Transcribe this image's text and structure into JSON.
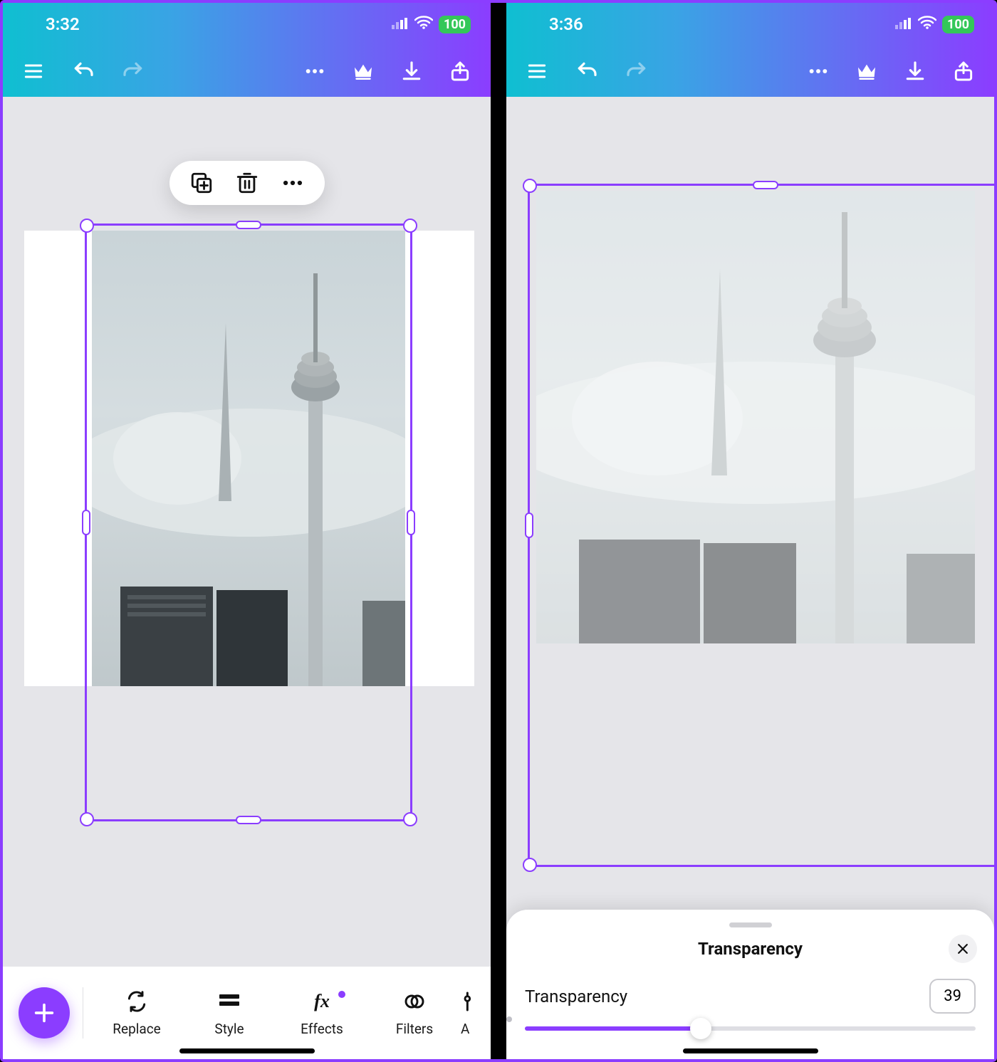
{
  "left": {
    "status": {
      "time": "3:32",
      "battery": "100"
    },
    "toolbar": {
      "tools": [
        {
          "id": "replace",
          "label": "Replace"
        },
        {
          "id": "style",
          "label": "Style"
        },
        {
          "id": "effects",
          "label": "Effects",
          "badge": true
        },
        {
          "id": "filters",
          "label": "Filters"
        },
        {
          "id": "adjust",
          "label": "A"
        }
      ]
    }
  },
  "right": {
    "status": {
      "time": "3:36",
      "battery": "100"
    },
    "sheet": {
      "title": "Transparency",
      "row_label": "Transparency",
      "value": "39",
      "percent": 39
    }
  }
}
